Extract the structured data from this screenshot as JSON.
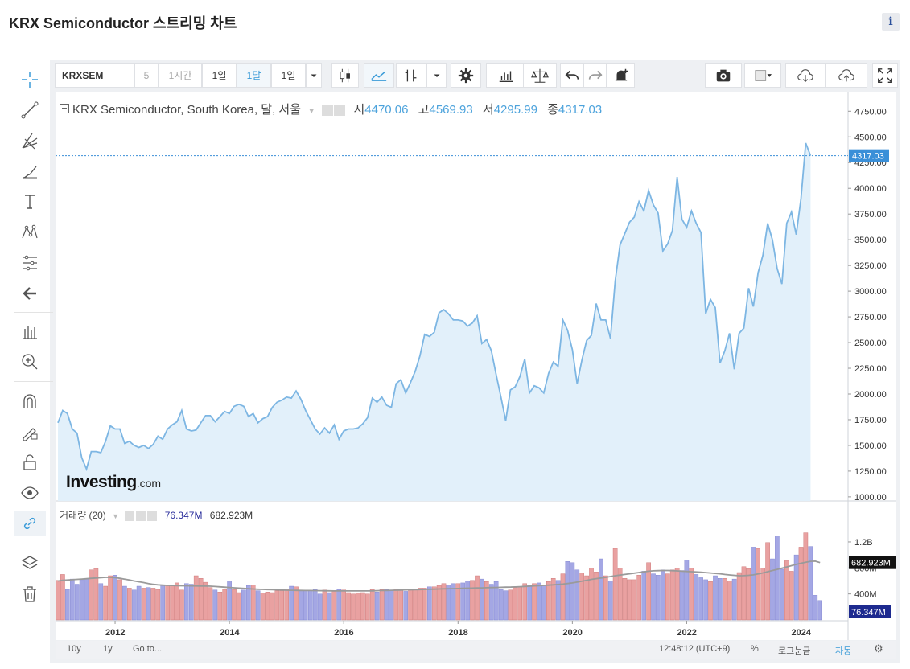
{
  "page": {
    "title": "KRX Semiconductor 스트리밍 차트",
    "info_label": "i"
  },
  "toolbar": {
    "symbol": "KRXSEM",
    "interval_5": "5",
    "interval_1h": "1시간",
    "interval_1d": "1일",
    "interval_1m": "1달",
    "range_1d": "1일"
  },
  "legend": {
    "instrument": "KRX Semiconductor, South Korea, 달, 서울",
    "open_label": "시",
    "open": "4470.06",
    "high_label": "고",
    "high": "4569.93",
    "low_label": "저",
    "low": "4295.99",
    "close_label": "종",
    "close": "4317.03",
    "volume_label": "거래량 (20)",
    "volume_value": "76.347M",
    "volume_ma": "682.923M"
  },
  "watermark": {
    "brand": "Investing",
    "suffix": ".com"
  },
  "bottom": {
    "range_10y": "10y",
    "range_1y": "1y",
    "goto": "Go to...",
    "clock": "12:48:12 (UTC+9)",
    "percent": "%",
    "log": "로그눈금",
    "auto": "자동"
  },
  "colors": {
    "line": "#7db6e3",
    "area": "#e2f0fa",
    "vol_up": "#e9a1a1",
    "vol_down": "#a4a7e4",
    "ma": "#9a9a9a",
    "price_tag": "#3a8fd8"
  },
  "chart_data": [
    {
      "type": "area",
      "title": "KRX Semiconductor, South Korea, 달, 서울",
      "x_start": "2011-01",
      "x_ticks": [
        "2012",
        "2014",
        "2016",
        "2018",
        "2020",
        "2022",
        "2024"
      ],
      "y_ticks": [
        "1000.00",
        "1250.00",
        "1500.00",
        "1750.00",
        "2000.00",
        "2250.00",
        "2500.00",
        "2750.00",
        "3000.00",
        "3250.00",
        "3500.00",
        "3750.00",
        "4000.00",
        "4250.00",
        "4500.00",
        "4750.00"
      ],
      "ylim": [
        960,
        4940
      ],
      "last_price": "4317.03",
      "values": [
        1720,
        1840,
        1810,
        1660,
        1620,
        1380,
        1270,
        1440,
        1440,
        1430,
        1540,
        1690,
        1660,
        1660,
        1520,
        1540,
        1500,
        1480,
        1500,
        1470,
        1510,
        1590,
        1560,
        1660,
        1700,
        1730,
        1840,
        1660,
        1640,
        1650,
        1720,
        1790,
        1790,
        1730,
        1780,
        1830,
        1810,
        1880,
        1900,
        1880,
        1780,
        1810,
        1720,
        1760,
        1780,
        1870,
        1920,
        1940,
        1970,
        1960,
        2030,
        1950,
        1840,
        1750,
        1660,
        1610,
        1670,
        1620,
        1700,
        1560,
        1640,
        1660,
        1660,
        1670,
        1710,
        1770,
        1960,
        1920,
        1970,
        1890,
        1870,
        2100,
        2140,
        2010,
        2110,
        2220,
        2370,
        2580,
        2560,
        2600,
        2790,
        2820,
        2780,
        2720,
        2720,
        2710,
        2660,
        2690,
        2760,
        2490,
        2530,
        2420,
        2190,
        1970,
        1740,
        2040,
        2070,
        2170,
        2340,
        2010,
        2080,
        2060,
        2010,
        2200,
        2310,
        2270,
        2720,
        2620,
        2430,
        2100,
        2330,
        2520,
        2570,
        2880,
        2720,
        2720,
        2540,
        3100,
        3450,
        3560,
        3670,
        3720,
        3870,
        3780,
        3980,
        3840,
        3760,
        3390,
        3460,
        3590,
        4110,
        3700,
        3620,
        3780,
        3660,
        3570,
        2780,
        2920,
        2840,
        2300,
        2420,
        2590,
        2240,
        2590,
        2640,
        3030,
        2850,
        3180,
        3350,
        3660,
        3500,
        3220,
        3070,
        3660,
        3770,
        3550,
        3900,
        4440,
        4317
      ]
    },
    {
      "type": "bar",
      "title": "거래량 (20)",
      "y_ticks": [
        "400M",
        "800M",
        "1.2B"
      ],
      "ylim": [
        0,
        1620
      ],
      "last_volume": "76.347M",
      "ma20_last": "682.923M",
      "values_M": [
        610,
        700,
        470,
        630,
        550,
        620,
        640,
        770,
        790,
        560,
        520,
        680,
        690,
        620,
        520,
        490,
        460,
        520,
        490,
        500,
        490,
        470,
        540,
        530,
        530,
        570,
        460,
        560,
        550,
        680,
        640,
        580,
        500,
        460,
        430,
        470,
        600,
        470,
        420,
        460,
        530,
        540,
        450,
        410,
        430,
        420,
        450,
        450,
        480,
        520,
        510,
        450,
        460,
        450,
        470,
        400,
        460,
        420,
        440,
        470,
        460,
        420,
        400,
        410,
        420,
        400,
        470,
        430,
        470,
        470,
        460,
        470,
        480,
        440,
        470,
        480,
        490,
        490,
        510,
        510,
        530,
        560,
        540,
        560,
        560,
        570,
        600,
        610,
        680,
        630,
        590,
        550,
        590,
        470,
        450,
        460,
        500,
        510,
        560,
        530,
        560,
        570,
        540,
        590,
        640,
        610,
        710,
        900,
        880,
        770,
        720,
        680,
        800,
        740,
        940,
        680,
        600,
        1100,
        800,
        640,
        620,
        620,
        690,
        750,
        880,
        710,
        690,
        770,
        710,
        770,
        800,
        760,
        920,
        800,
        700,
        650,
        620,
        590,
        680,
        640,
        640,
        600,
        630,
        730,
        820,
        790,
        1120,
        1100,
        800,
        1190,
        940,
        1290,
        780,
        910,
        750,
        1000,
        1120,
        1340,
        1130,
        380,
        300
      ],
      "ma20_M": [
        600,
        610,
        615,
        620,
        625,
        630,
        635,
        640,
        645,
        650,
        655,
        655,
        650,
        640,
        628,
        615,
        600,
        588,
        575,
        560,
        548,
        540,
        535,
        532,
        530,
        528,
        526,
        525,
        524,
        523,
        522,
        522,
        520,
        515,
        510,
        505,
        500,
        495,
        490,
        485,
        480,
        476,
        473,
        470,
        468,
        465,
        462,
        460,
        458,
        456,
        455,
        454,
        453,
        452,
        451,
        450,
        449,
        448,
        447,
        446,
        446,
        446,
        446,
        446,
        446,
        447,
        448,
        450,
        452,
        454,
        456,
        458,
        460,
        462,
        464,
        466,
        468,
        470,
        472,
        474,
        476,
        478,
        480,
        482,
        484,
        486,
        488,
        490,
        492,
        494,
        496,
        498,
        500,
        502,
        504,
        506,
        508,
        512,
        516,
        520,
        524,
        528,
        532,
        536,
        540,
        545,
        552,
        560,
        570,
        582,
        596,
        610,
        624,
        636,
        646,
        656,
        668,
        680,
        690,
        700,
        710,
        720,
        730,
        740,
        750,
        755,
        758,
        760,
        760,
        758,
        754,
        750,
        746,
        742,
        738,
        733,
        728,
        722,
        716,
        710,
        700,
        692,
        686,
        680,
        682,
        686,
        694,
        708,
        724,
        742,
        760,
        778,
        796,
        815,
        835,
        855,
        872,
        888,
        902,
        904,
        882
      ]
    }
  ]
}
